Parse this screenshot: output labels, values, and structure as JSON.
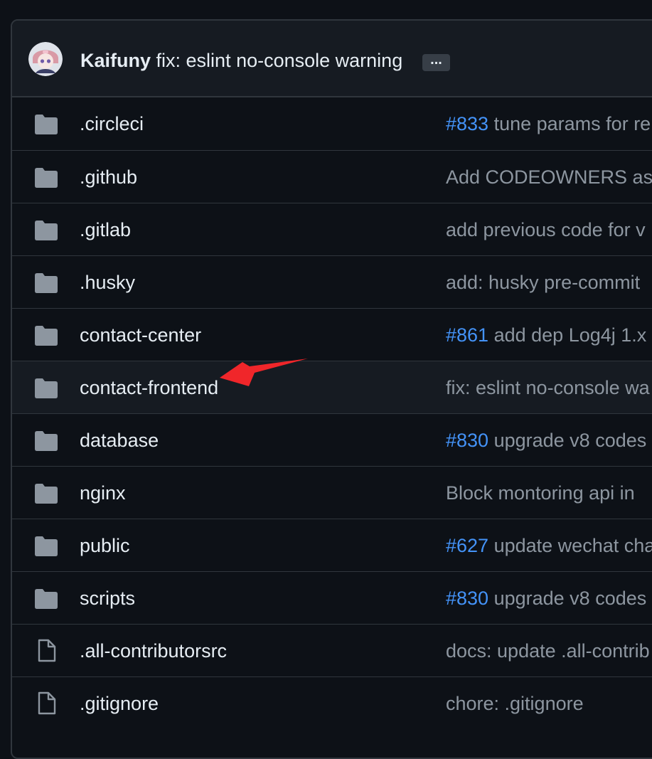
{
  "latest_commit": {
    "author": "Kaifuny",
    "message": "fix: eslint no-console warning",
    "more_label": "..."
  },
  "files": [
    {
      "name": ".circleci",
      "type": "folder",
      "pr": "#833",
      "message": "tune params for re"
    },
    {
      "name": ".github",
      "type": "folder",
      "pr": "",
      "message": "Add CODEOWNERS as c"
    },
    {
      "name": ".gitlab",
      "type": "folder",
      "pr": "",
      "message": "add previous code for v"
    },
    {
      "name": ".husky",
      "type": "folder",
      "pr": "",
      "message": "add: husky pre-commit"
    },
    {
      "name": "contact-center",
      "type": "folder",
      "pr": "#861",
      "message": "add dep Log4j 1.x"
    },
    {
      "name": "contact-frontend",
      "type": "folder",
      "pr": "",
      "message": "fix: eslint no-console wa"
    },
    {
      "name": "database",
      "type": "folder",
      "pr": "#830",
      "message": "upgrade v8 codes"
    },
    {
      "name": "nginx",
      "type": "folder",
      "pr": "",
      "message": "Block montoring api in"
    },
    {
      "name": "public",
      "type": "folder",
      "pr": "#627",
      "message": "update wechat cha"
    },
    {
      "name": "scripts",
      "type": "folder",
      "pr": "#830",
      "message": "upgrade v8 codes"
    },
    {
      "name": ".all-contributorsrc",
      "type": "file",
      "pr": "",
      "message": "docs: update .all-contrib"
    },
    {
      "name": ".gitignore",
      "type": "file",
      "pr": "",
      "message": "chore: .gitignore"
    }
  ],
  "highlighted_file": "contact-frontend",
  "colors": {
    "background": "#0d1117",
    "header_bg": "#161b22",
    "border": "#30363d",
    "text": "#e6edf3",
    "muted_text": "#8d96a0",
    "link": "#4493f8",
    "icon": "#8d96a0",
    "annotation_arrow": "#f0262a"
  },
  "icons": {
    "folder": "folder-icon",
    "file": "file-icon",
    "annotation": "red-arrow-annotation-icon"
  }
}
